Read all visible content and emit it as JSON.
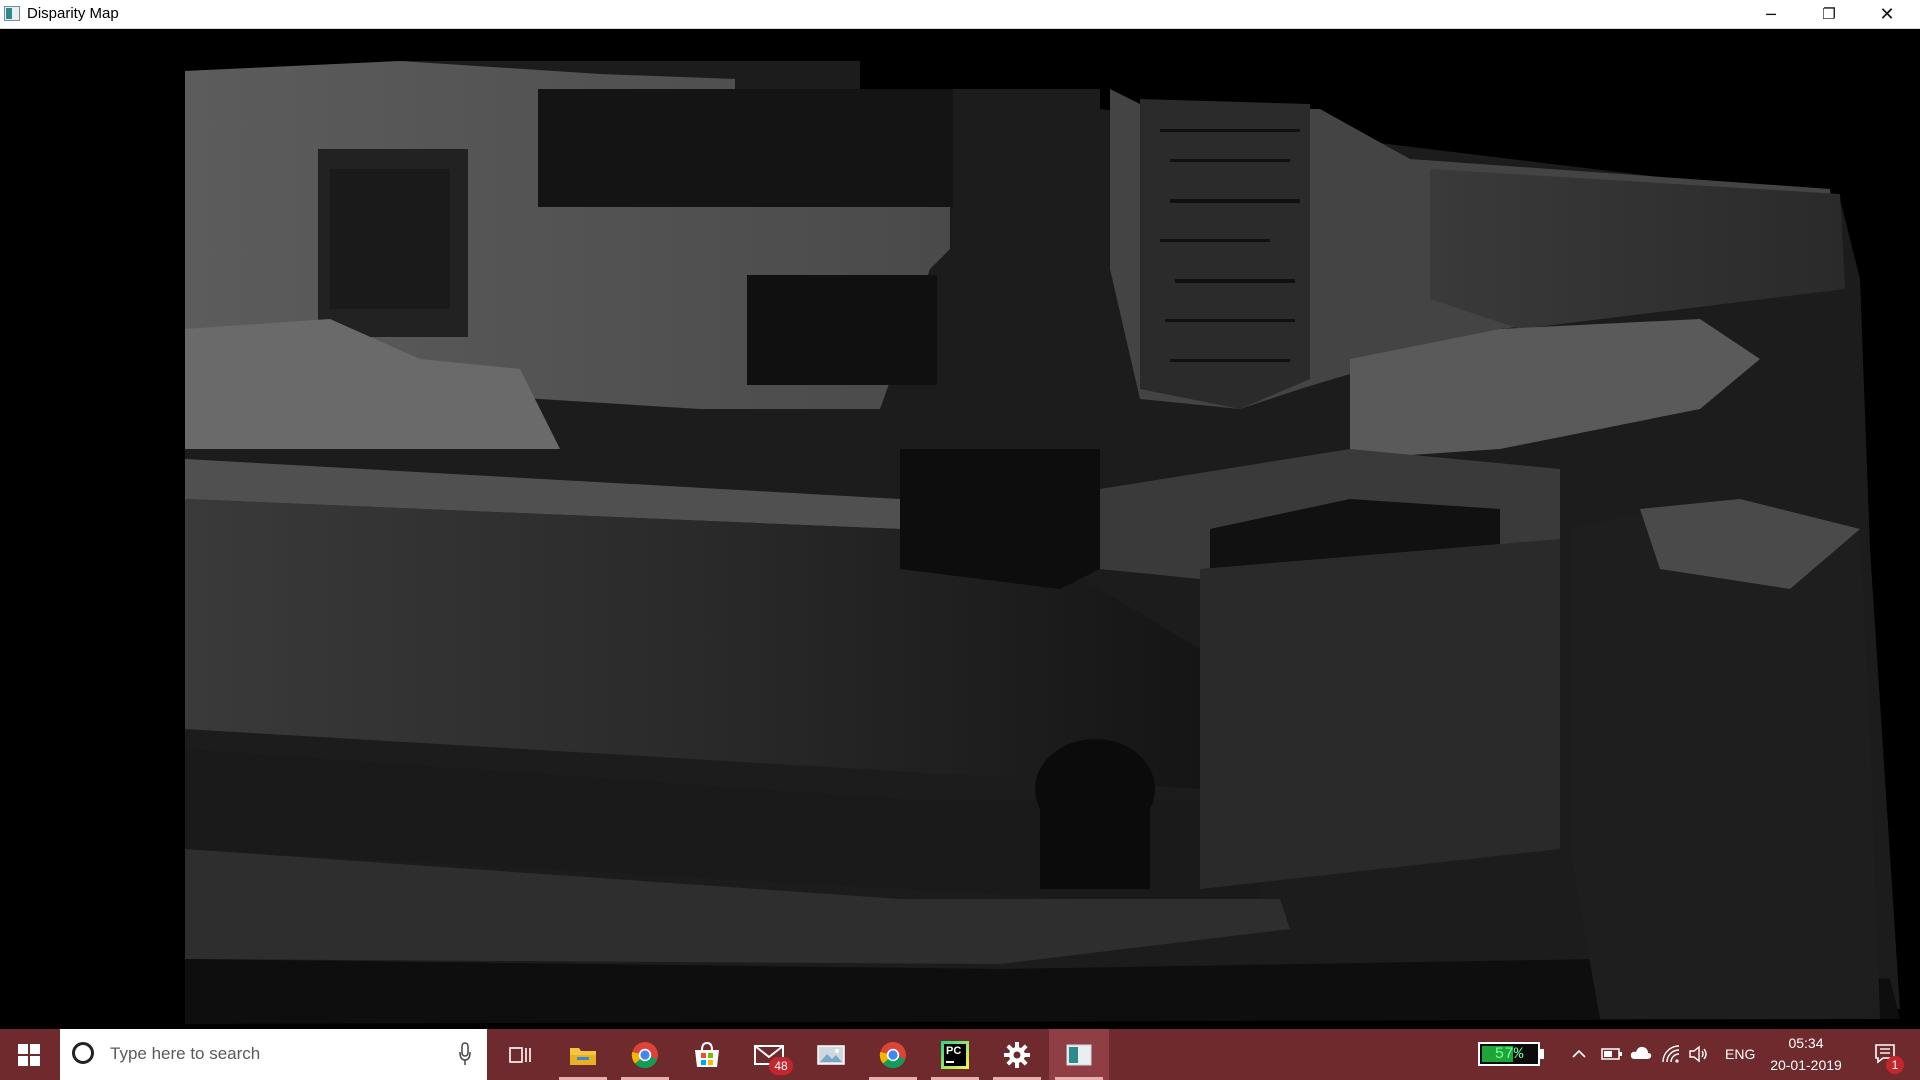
{
  "window": {
    "title": "Disparity Map",
    "controls": {
      "minimize": "─",
      "maximize": "❐",
      "close": "✕"
    }
  },
  "taskbar": {
    "search": {
      "placeholder": "Type here to search"
    },
    "apps": [
      {
        "name": "task-view",
        "icon": "task-view-icon"
      },
      {
        "name": "file-explorer",
        "icon": "folder-icon"
      },
      {
        "name": "chrome",
        "icon": "chrome-icon"
      },
      {
        "name": "store",
        "icon": "store-icon"
      },
      {
        "name": "mail",
        "icon": "mail-icon",
        "badge": "48"
      },
      {
        "name": "photos",
        "icon": "photos-icon"
      },
      {
        "name": "chrome-2",
        "icon": "chrome-icon"
      },
      {
        "name": "pycharm",
        "icon": "pycharm-icon",
        "label": "PC"
      },
      {
        "name": "settings",
        "icon": "gear-icon"
      },
      {
        "name": "disparity-map",
        "icon": "window-icon",
        "active": true
      }
    ],
    "tray": {
      "battery_percent_text": "57%",
      "battery_level": 0.57,
      "language": "ENG",
      "time": "05:34",
      "date": "20-01-2019",
      "notifications": "1"
    }
  },
  "colors": {
    "taskbar": "#6e2a2d",
    "battery_fill": "#1fa43a",
    "badge": "#c4262e"
  }
}
